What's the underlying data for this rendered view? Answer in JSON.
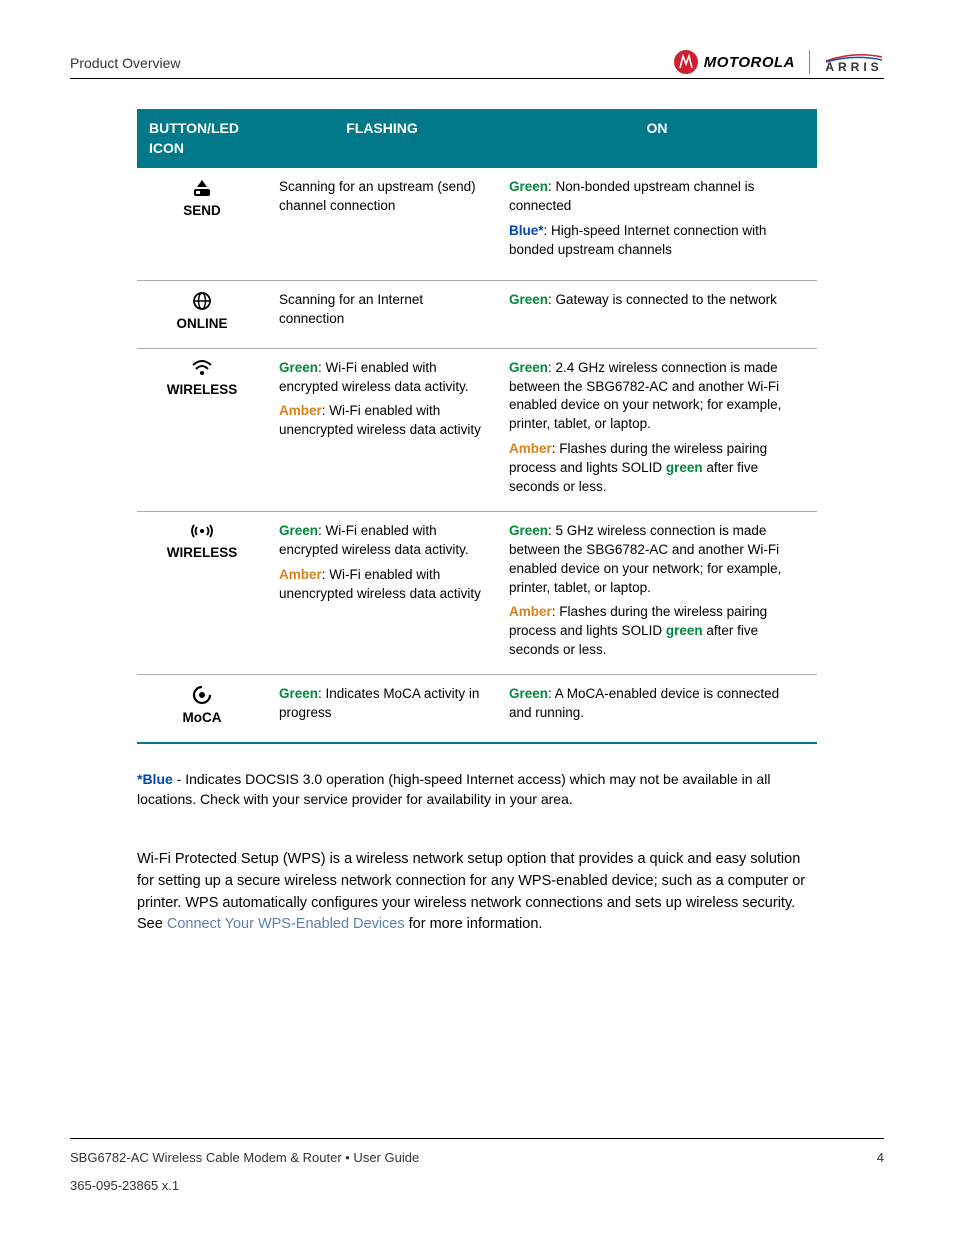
{
  "header": {
    "section_title": "Product Overview",
    "brand1": "MOTOROLA",
    "brand2": "ARRIS"
  },
  "table": {
    "headers": {
      "col1": "BUTTON/LED ICON",
      "col2": "FLASHING",
      "col3": "ON"
    },
    "rows": [
      {
        "icon_label": "SEND",
        "flashing_plain": "Scanning for an upstream (send) channel connection",
        "on_green_label": "Green",
        "on_green_text": ": Non-bonded upstream channel is connected",
        "on_blue_label": "Blue*",
        "on_blue_text": ": High-speed Internet connection with bonded upstream channels"
      },
      {
        "icon_label": "ONLINE",
        "flashing_plain": "Scanning for an Internet connection",
        "on_green_label": "Green",
        "on_green_text": ": Gateway is connected to the network"
      },
      {
        "icon_label": "WIRELESS",
        "flash_green_label": "Green",
        "flash_green_text": ": Wi-Fi enabled with encrypted wireless data activity.",
        "flash_amber_label": "Amber",
        "flash_amber_text": ": Wi-Fi enabled with unencrypted wireless data activity",
        "on_green_label": "Green",
        "on_green_text": ": 2.4 GHz wireless connection is made between the SBG6782-AC and another Wi-Fi enabled device on your network; for example, printer, tablet, or laptop.",
        "on_amber_label": "Amber",
        "on_amber_pre": ": Flashes during the wireless pairing process and lights SOLID ",
        "on_amber_green_word": "green",
        "on_amber_post": " after five seconds or less."
      },
      {
        "icon_label": "WIRELESS",
        "flash_green_label": "Green",
        "flash_green_text": ": Wi-Fi enabled with encrypted wireless data activity.",
        "flash_amber_label": "Amber",
        "flash_amber_text": ": Wi-Fi enabled with unencrypted wireless data activity",
        "on_green_label": "Green",
        "on_green_text": ": 5 GHz wireless connection is made between the SBG6782-AC and another Wi-Fi enabled device on your network; for example, printer, tablet, or laptop.",
        "on_amber_label": "Amber",
        "on_amber_pre": ": Flashes during the wireless pairing process and lights SOLID ",
        "on_amber_green_word": "green",
        "on_amber_post": " after five seconds or less."
      },
      {
        "icon_label": "MoCA",
        "flash_green_label": "Green",
        "flash_green_text": ": Indicates MoCA activity in progress",
        "on_green_label": "Green",
        "on_green_text": ": A MoCA-enabled device is connected and running."
      }
    ]
  },
  "footnote": {
    "label": "*Blue",
    "text": " - Indicates DOCSIS 3.0 operation (high-speed Internet access) which may not be available in all locations. Check with your service provider for availability in your area."
  },
  "wps": {
    "pre": "Wi-Fi Protected Setup (WPS) is a wireless network setup option that provides a quick and easy solution for setting up a secure wireless network connection for any WPS-enabled device; such as a computer or printer. WPS automatically configures your wireless network connections and sets up wireless security. See ",
    "link": "Connect Your WPS-Enabled Devices",
    "post": " for more information."
  },
  "footer": {
    "doc_title": "SBG6782-AC Wireless Cable Modem & Router • User Guide",
    "page": "4",
    "doc_number": "365-095-23865  x.1"
  }
}
